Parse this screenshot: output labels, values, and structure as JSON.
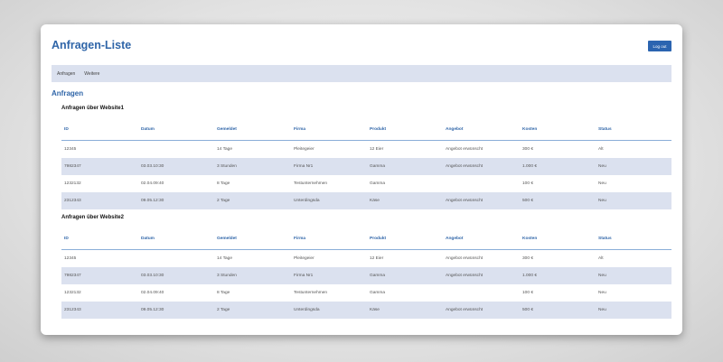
{
  "header": {
    "title": "Anfragen-Liste",
    "logout_label": "Log out"
  },
  "nav": {
    "items": [
      "Anfragen",
      "Weitere"
    ]
  },
  "section_title": "Anfragen",
  "columns": [
    "ID",
    "Datum",
    "Gemeldet",
    "Firma",
    "Produkt",
    "Angebot",
    "Kosten",
    "Status"
  ],
  "tables": [
    {
      "title": "Anfragen über Website1",
      "rows": [
        [
          "12345",
          "",
          "14 Tage",
          "Pleitegeier",
          "12 Eier",
          "Angebot erwünscht",
          "300 €",
          "Alt"
        ],
        [
          "7982347",
          "03.03.10:30",
          "3 Stunden",
          "Firma Nr1",
          "Gamma",
          "Angebot erwünscht",
          "1.000 €",
          "Neu"
        ],
        [
          "1232132",
          "02.04.09:40",
          "8 Tage",
          "Testunternehmen",
          "Gamma",
          "",
          "100 €",
          "Neu"
        ],
        [
          "2312343",
          "09.05.12:30",
          "2 Tage",
          "Unterdingsda",
          "Käse",
          "Angebot erwünscht",
          "500 €",
          "Neu"
        ]
      ]
    },
    {
      "title": "Anfragen über Website2",
      "rows": [
        [
          "12345",
          "",
          "14 Tage",
          "Pleitegeier",
          "12 Eier",
          "Angebot erwünscht",
          "300 €",
          "Alt"
        ],
        [
          "7982347",
          "03.03.10:30",
          "3 Stunden",
          "Firma Nr1",
          "Gamma",
          "Angebot erwünscht",
          "1.000 €",
          "Neu"
        ],
        [
          "1232132",
          "02.04.09:40",
          "8 Tage",
          "Testunternehmen",
          "Gamma",
          "",
          "100 €",
          "Neu"
        ],
        [
          "2312343",
          "09.05.12:30",
          "2 Tage",
          "Unterdingsda",
          "Käse",
          "Angebot erwünscht",
          "500 €",
          "Neu"
        ]
      ]
    }
  ],
  "colors": {
    "accent": "#2f65a8",
    "button": "#2b64b0",
    "stripe": "#dbe1ef"
  }
}
